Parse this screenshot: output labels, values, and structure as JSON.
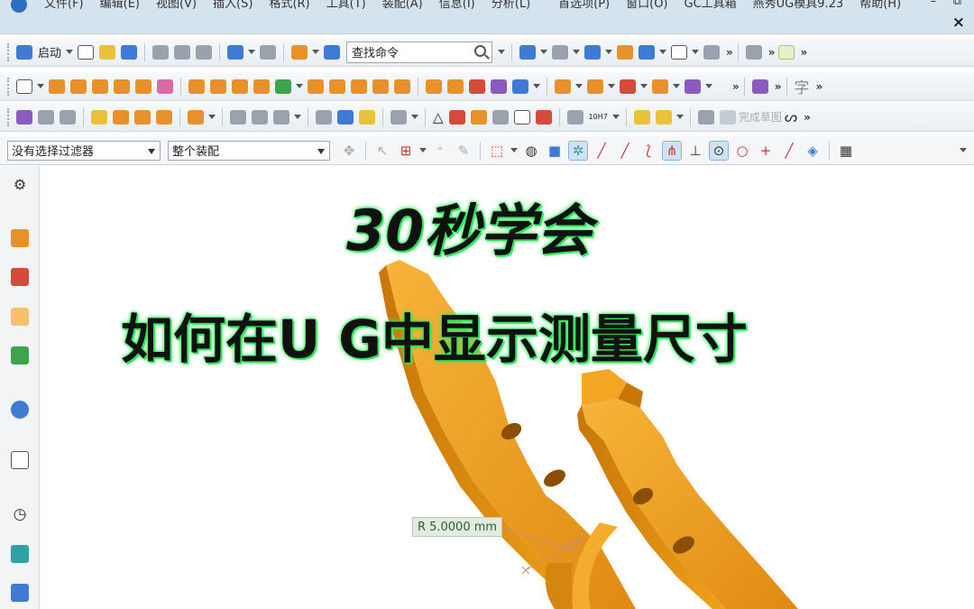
{
  "menu": {
    "items": [
      "文件(F)",
      "编辑(E)",
      "视图(V)",
      "插入(S)",
      "格式(R)",
      "工具(T)",
      "装配(A)",
      "信息(I)",
      "分析(L)",
      "首选项(P)",
      "窗口(O)",
      "GC工具箱",
      "燕秀UG模具9.23",
      "帮助(H)"
    ],
    "minimize": "–",
    "restore": "⧉",
    "close": "×"
  },
  "toolbar": {
    "start_label": "启动",
    "search_placeholder": "查找命令",
    "more": "»",
    "text_icon": "字",
    "tolerance_label": "10H7",
    "finish_sketch": "完成草图"
  },
  "filter": {
    "type_filter": "没有选择过滤器",
    "scope": "整个装配"
  },
  "title": {
    "line1": "30秒学会",
    "line2": "如何在U G中显示测量尺寸"
  },
  "measurement": {
    "label": "R 5.0000 mm"
  },
  "colors": {
    "part": "#f0a21a",
    "part_shadow": "#c87a0a",
    "title_glow": "#2ee85a",
    "chrome": "#d5e3ef"
  }
}
